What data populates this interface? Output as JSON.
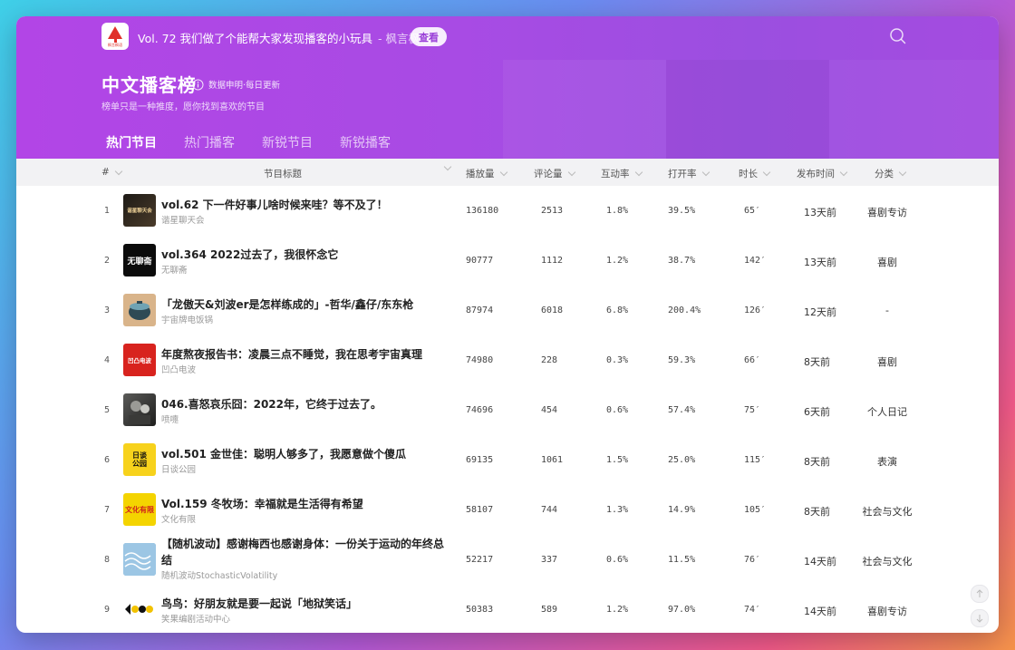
{
  "topbar": {
    "announcement": "Vol. 72 我们做了个能帮大家发现播客的小玩具",
    "source": "- 枫言枫语",
    "view_label": "查看",
    "logo_text": "枫言枫语"
  },
  "page": {
    "title": "中文播客榜",
    "title_note": "数据申明·每日更新",
    "subtitle": "榜单只是一种推度，愿你找到喜欢的节目"
  },
  "tabs": [
    "热门节目",
    "热门播客",
    "新锐节目",
    "新锐播客"
  ],
  "columns": {
    "rank": "#",
    "title": "节目标题",
    "plays": "播放量",
    "comments": "评论量",
    "interaction": "互动率",
    "open_rate": "打开率",
    "duration": "时长",
    "published": "发布时间",
    "category": "分类"
  },
  "rows": [
    {
      "rank": "1",
      "title": "vol.62 下一件好事儿啥时候来哇？等不及了！",
      "podcast": "谐星聊天会",
      "plays": "136180",
      "comments": "2513",
      "interaction": "1.8%",
      "open_rate": "39.5%",
      "duration": "65′",
      "published": "13天前",
      "category": "喜剧专访",
      "cover_text": "谐星聊天会"
    },
    {
      "rank": "2",
      "title": "vol.364 2022过去了，我很怀念它",
      "podcast": "无聊斋",
      "plays": "90777",
      "comments": "1112",
      "interaction": "1.2%",
      "open_rate": "38.7%",
      "duration": "142′",
      "published": "13天前",
      "category": "喜剧",
      "cover_text": "无聊斋"
    },
    {
      "rank": "3",
      "title": "「龙傲天&刘波er是怎样练成的」-哲华/鑫仔/东东枪",
      "podcast": "宇宙牌电饭锅",
      "plays": "87974",
      "comments": "6018",
      "interaction": "6.8%",
      "open_rate": "200.4%",
      "duration": "126′",
      "published": "12天前",
      "category": "-",
      "cover_text": ""
    },
    {
      "rank": "4",
      "title": "年度熬夜报告书：凌晨三点不睡觉，我在思考宇宙真理",
      "podcast": "凹凸电波",
      "plays": "74980",
      "comments": "228",
      "interaction": "0.3%",
      "open_rate": "59.3%",
      "duration": "66′",
      "published": "8天前",
      "category": "喜剧",
      "cover_text": "凹凸电波"
    },
    {
      "rank": "5",
      "title": "046.喜怒哀乐囧：2022年，它终于过去了。",
      "podcast": "喷嚏",
      "plays": "74696",
      "comments": "454",
      "interaction": "0.6%",
      "open_rate": "57.4%",
      "duration": "75′",
      "published": "6天前",
      "category": "个人日记",
      "cover_text": ""
    },
    {
      "rank": "6",
      "title": "vol.501 金世佳：聪明人够多了，我愿意做个傻瓜",
      "podcast": "日谈公园",
      "plays": "69135",
      "comments": "1061",
      "interaction": "1.5%",
      "open_rate": "25.0%",
      "duration": "115′",
      "published": "8天前",
      "category": "表演",
      "cover_text": "日谈公园"
    },
    {
      "rank": "7",
      "title": "Vol.159 冬牧场：幸福就是生活得有希望",
      "podcast": "文化有限",
      "plays": "58107",
      "comments": "744",
      "interaction": "1.3%",
      "open_rate": "14.9%",
      "duration": "105′",
      "published": "8天前",
      "category": "社会与文化",
      "cover_text": "文化有限"
    },
    {
      "rank": "8",
      "title": "【随机波动】感谢梅西也感谢身体：一份关于运动的年终总结",
      "podcast": "随机波动StochasticVolatility",
      "plays": "52217",
      "comments": "337",
      "interaction": "0.6%",
      "open_rate": "11.5%",
      "duration": "76′",
      "published": "14天前",
      "category": "社会与文化",
      "cover_text": ""
    },
    {
      "rank": "9",
      "title": "鸟鸟：好朋友就是要一起说「地狱笑话」",
      "podcast": "笑果编剧活动中心",
      "plays": "50383",
      "comments": "589",
      "interaction": "1.2%",
      "open_rate": "97.0%",
      "duration": "74′",
      "published": "14天前",
      "category": "喜剧专访",
      "cover_text": ""
    }
  ]
}
